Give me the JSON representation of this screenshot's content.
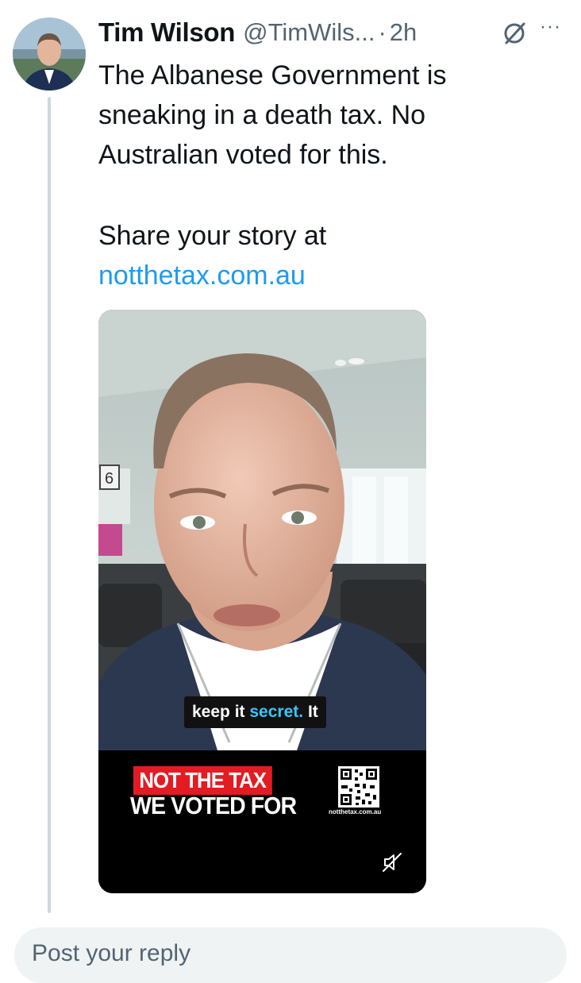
{
  "tweet": {
    "author_name": "Tim Wilson",
    "handle": "@TimWils...",
    "separator": "·",
    "time": "2h",
    "more_label": "···",
    "text_lines": [
      "The Albanese Government is sneaking in a death tax. No Australian voted for this."
    ],
    "share_prefix": "Share your story at",
    "link": "notthetax.com.au"
  },
  "media": {
    "sign_text": "6",
    "caption_prefix": "keep it",
    "caption_highlight": "secret.",
    "caption_suffix": "It",
    "banner_line1": "NOT THE TAX",
    "banner_line2": "WE VOTED FOR",
    "qr_url": "notthetax.com.au",
    "mute_icon": "speaker-muted-icon"
  },
  "reply": {
    "placeholder": "Post your reply"
  },
  "colors": {
    "link": "#1d9bf0",
    "banner_red": "#e31b23",
    "caption_highlight": "#39c5f5",
    "thread_line": "#cfd9de"
  }
}
